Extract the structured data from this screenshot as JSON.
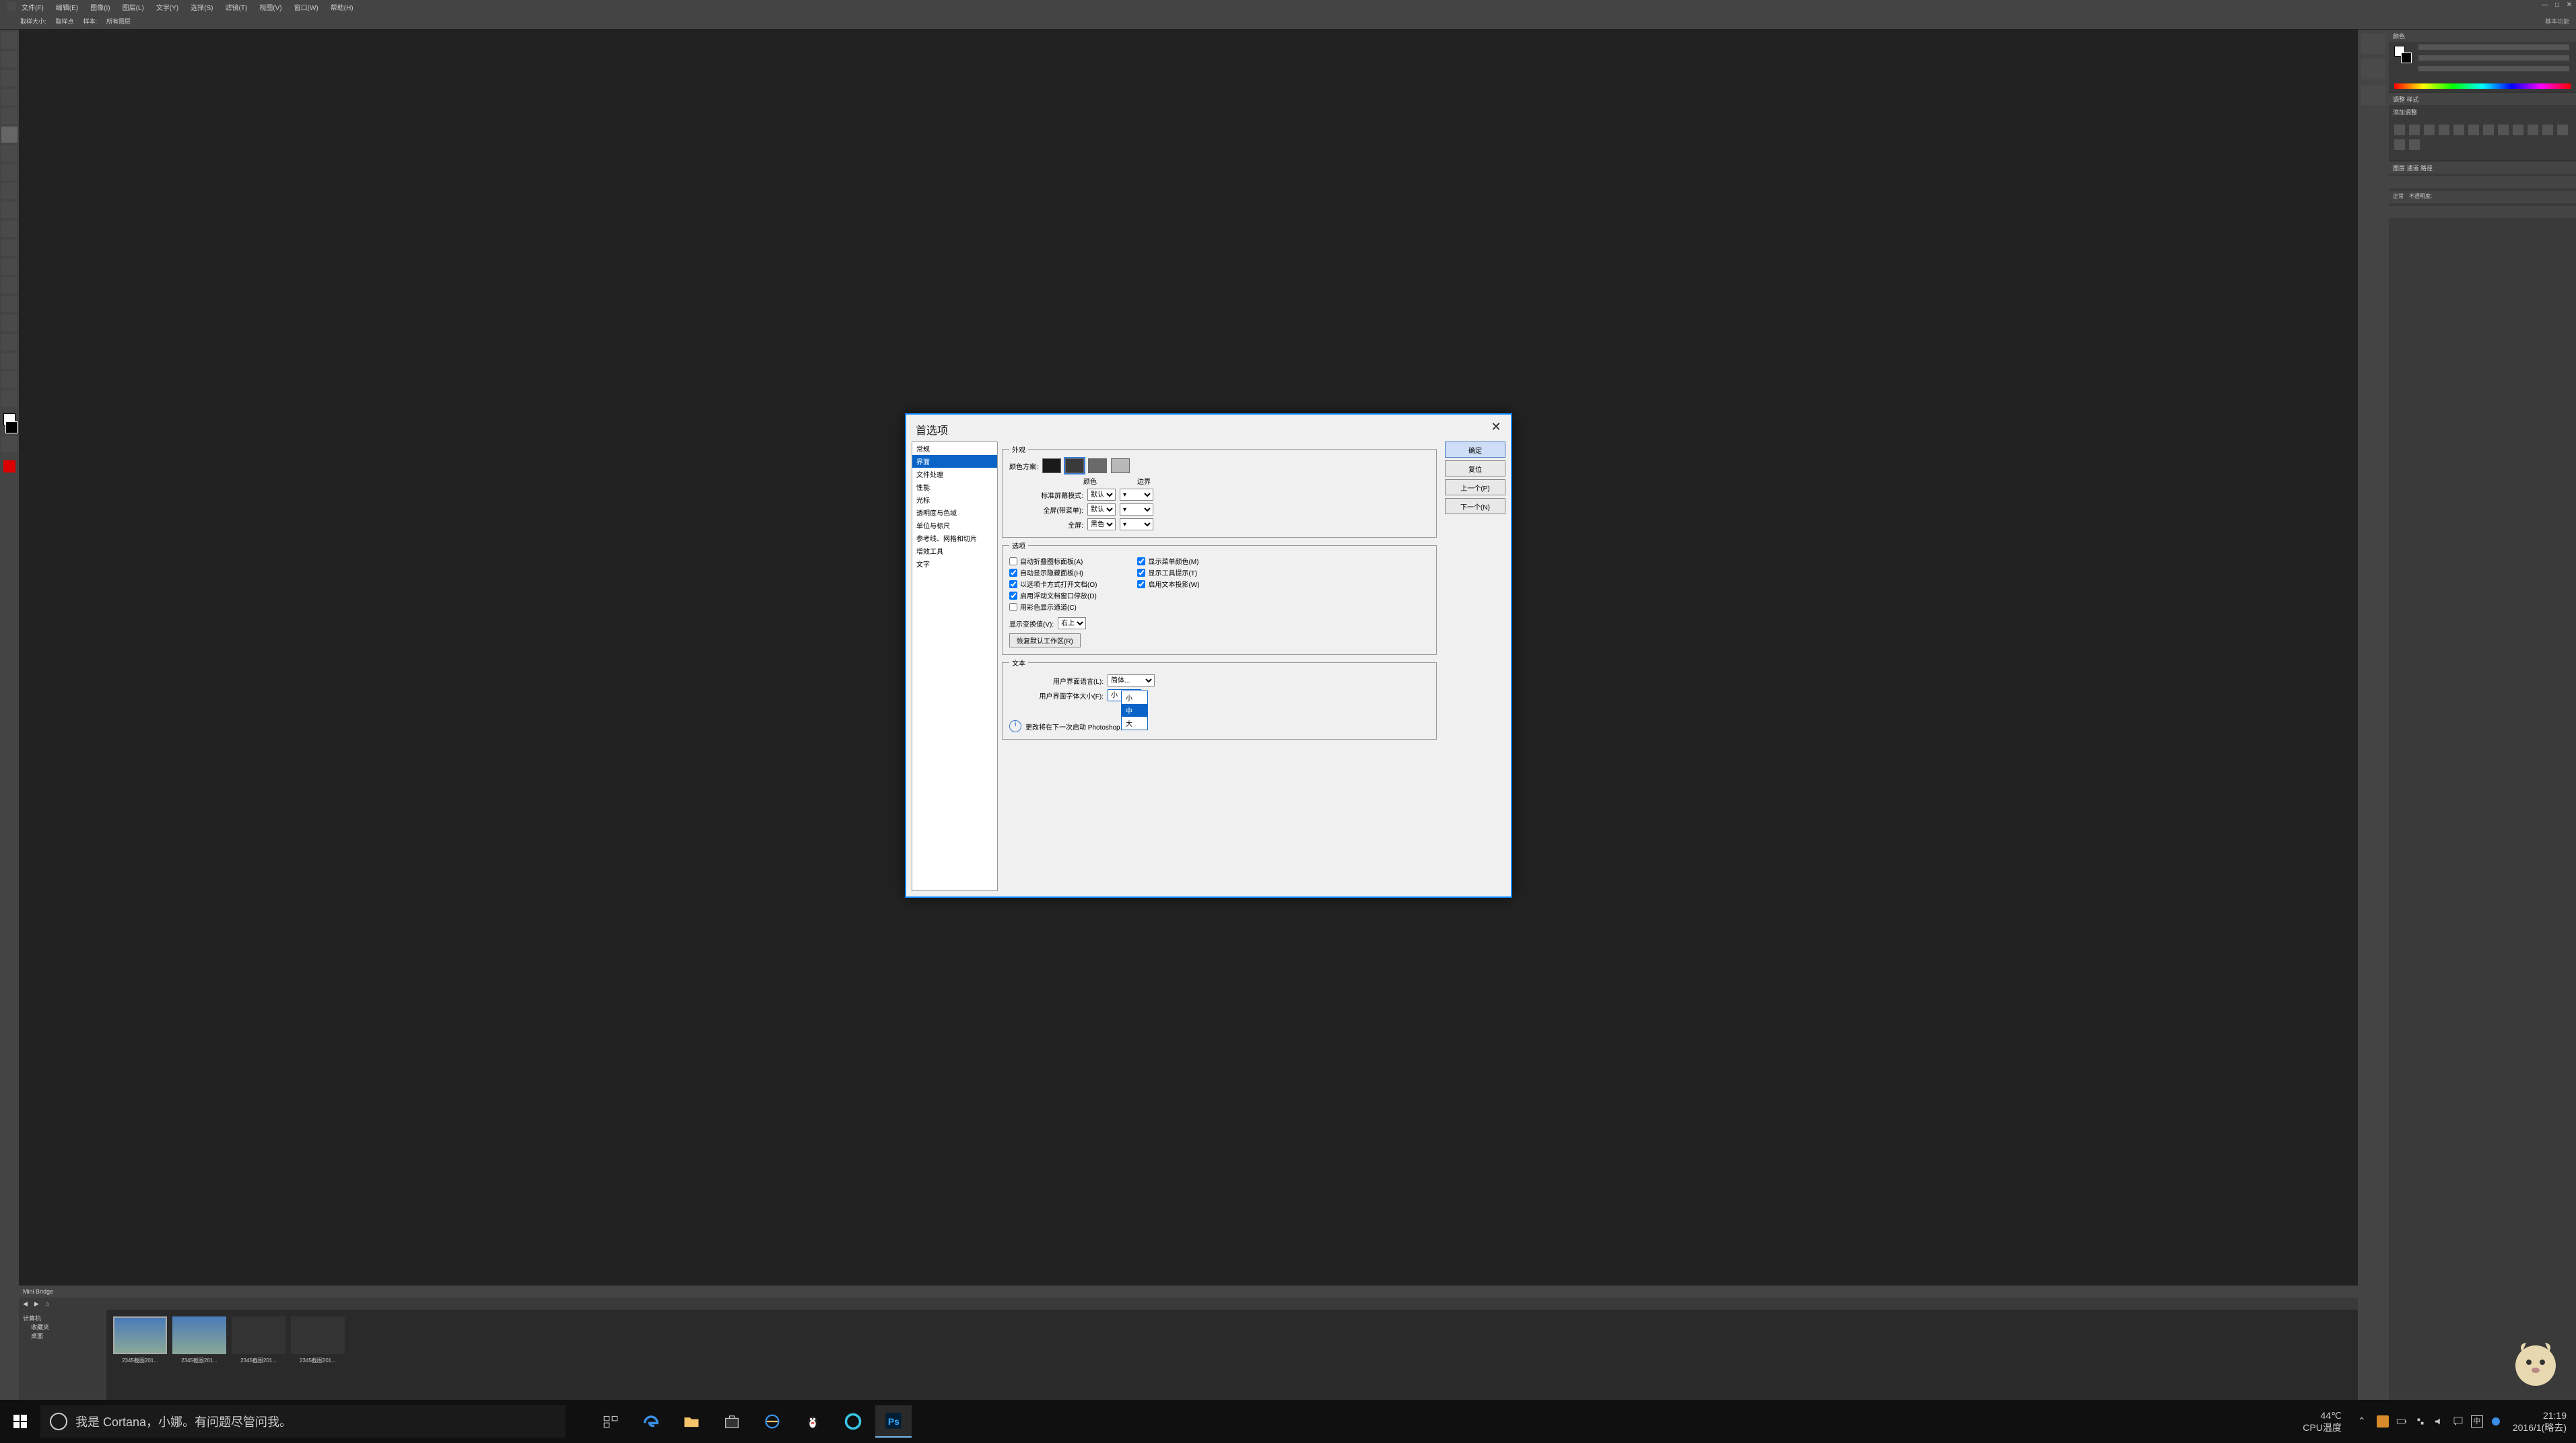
{
  "menubar": {
    "items": [
      "文件(F)",
      "编辑(E)",
      "图像(I)",
      "图层(L)",
      "文字(Y)",
      "选择(S)",
      "滤镜(T)",
      "视图(V)",
      "窗口(W)",
      "帮助(H)"
    ]
  },
  "optbar": {
    "label1": "取样大小:",
    "value1": "取样点",
    "label2": "样本:",
    "value2": "所有图层",
    "right": "基本功能"
  },
  "minibridge": {
    "title": "Mini Bridge",
    "sidebar_root": "计算机",
    "sidebar_items": [
      "收藏夹",
      "桌面"
    ],
    "thumbs": [
      {
        "cap": "2345截图201..."
      },
      {
        "cap": "2345截图201..."
      },
      {
        "cap": "2345截图201..."
      },
      {
        "cap": "2345截图201..."
      }
    ]
  },
  "rightpanels": {
    "color_tab": "颜色",
    "adj_tabs": "调整  样式",
    "adj_title": "添加调整",
    "layers_tabs": "图层  通道  路径",
    "lyr_kind": "正常",
    "lyr_opacity": "不透明度:"
  },
  "pref": {
    "title": "首选项",
    "cats": [
      "常规",
      "界面",
      "文件处理",
      "性能",
      "光标",
      "透明度与色域",
      "单位与标尺",
      "参考线、网格和切片",
      "增效工具",
      "文字"
    ],
    "active_cat_index": 1,
    "section_appearance": "外观",
    "color_scheme_label": "颜色方案:",
    "swatches": [
      "#1a1a1a",
      "#3a3a3a",
      "#6a6a6a",
      "#b8b8b8"
    ],
    "swatch_selected": 1,
    "col_color": "颜色",
    "col_border": "边界",
    "row_std": "标准屏幕模式:",
    "row_full_menu": "全屏(带菜单):",
    "row_full": "全屏:",
    "val_default": "默认",
    "val_black": "黑色",
    "section_options": "选项",
    "chk_auto_collapse": "自动折叠图标面板(A)",
    "chk_auto_show_hidden": "自动显示隐藏面板(H)",
    "chk_open_as_tabs": "以选项卡方式打开文档(O)",
    "chk_floating_dock": "启用浮动文档窗口停放(D)",
    "chk_show_channels_color": "用彩色显示通道(C)",
    "chk_show_menu_colors": "显示菜单颜色(M)",
    "chk_show_tooltips": "显示工具提示(T)",
    "chk_enable_text_shadow": "启用文本投影(W)",
    "show_transform_label": "显示变换值(V):",
    "show_transform_value": "右上",
    "reset_workspace": "恢复默认工作区(R)",
    "section_text": "文本",
    "ui_lang_label": "用户界面语言(L):",
    "ui_lang_value": "简体...",
    "ui_font_label": "用户界面字体大小(F):",
    "ui_font_value": "小",
    "note": "更改将在下一次启动 Photoshop 时生效。",
    "size_options": [
      "小",
      "中",
      "大"
    ],
    "btn_ok": "确定",
    "btn_cancel": "复位",
    "btn_prev": "上一个(P)",
    "btn_next": "下一个(N)"
  },
  "taskbar": {
    "cortana": "我是 Cortana，小娜。有问题尽管问我。",
    "temp": "44℃",
    "temp_label": "CPU温度",
    "ime": "中",
    "time": "21:19",
    "date": "2016/1(略去)"
  }
}
